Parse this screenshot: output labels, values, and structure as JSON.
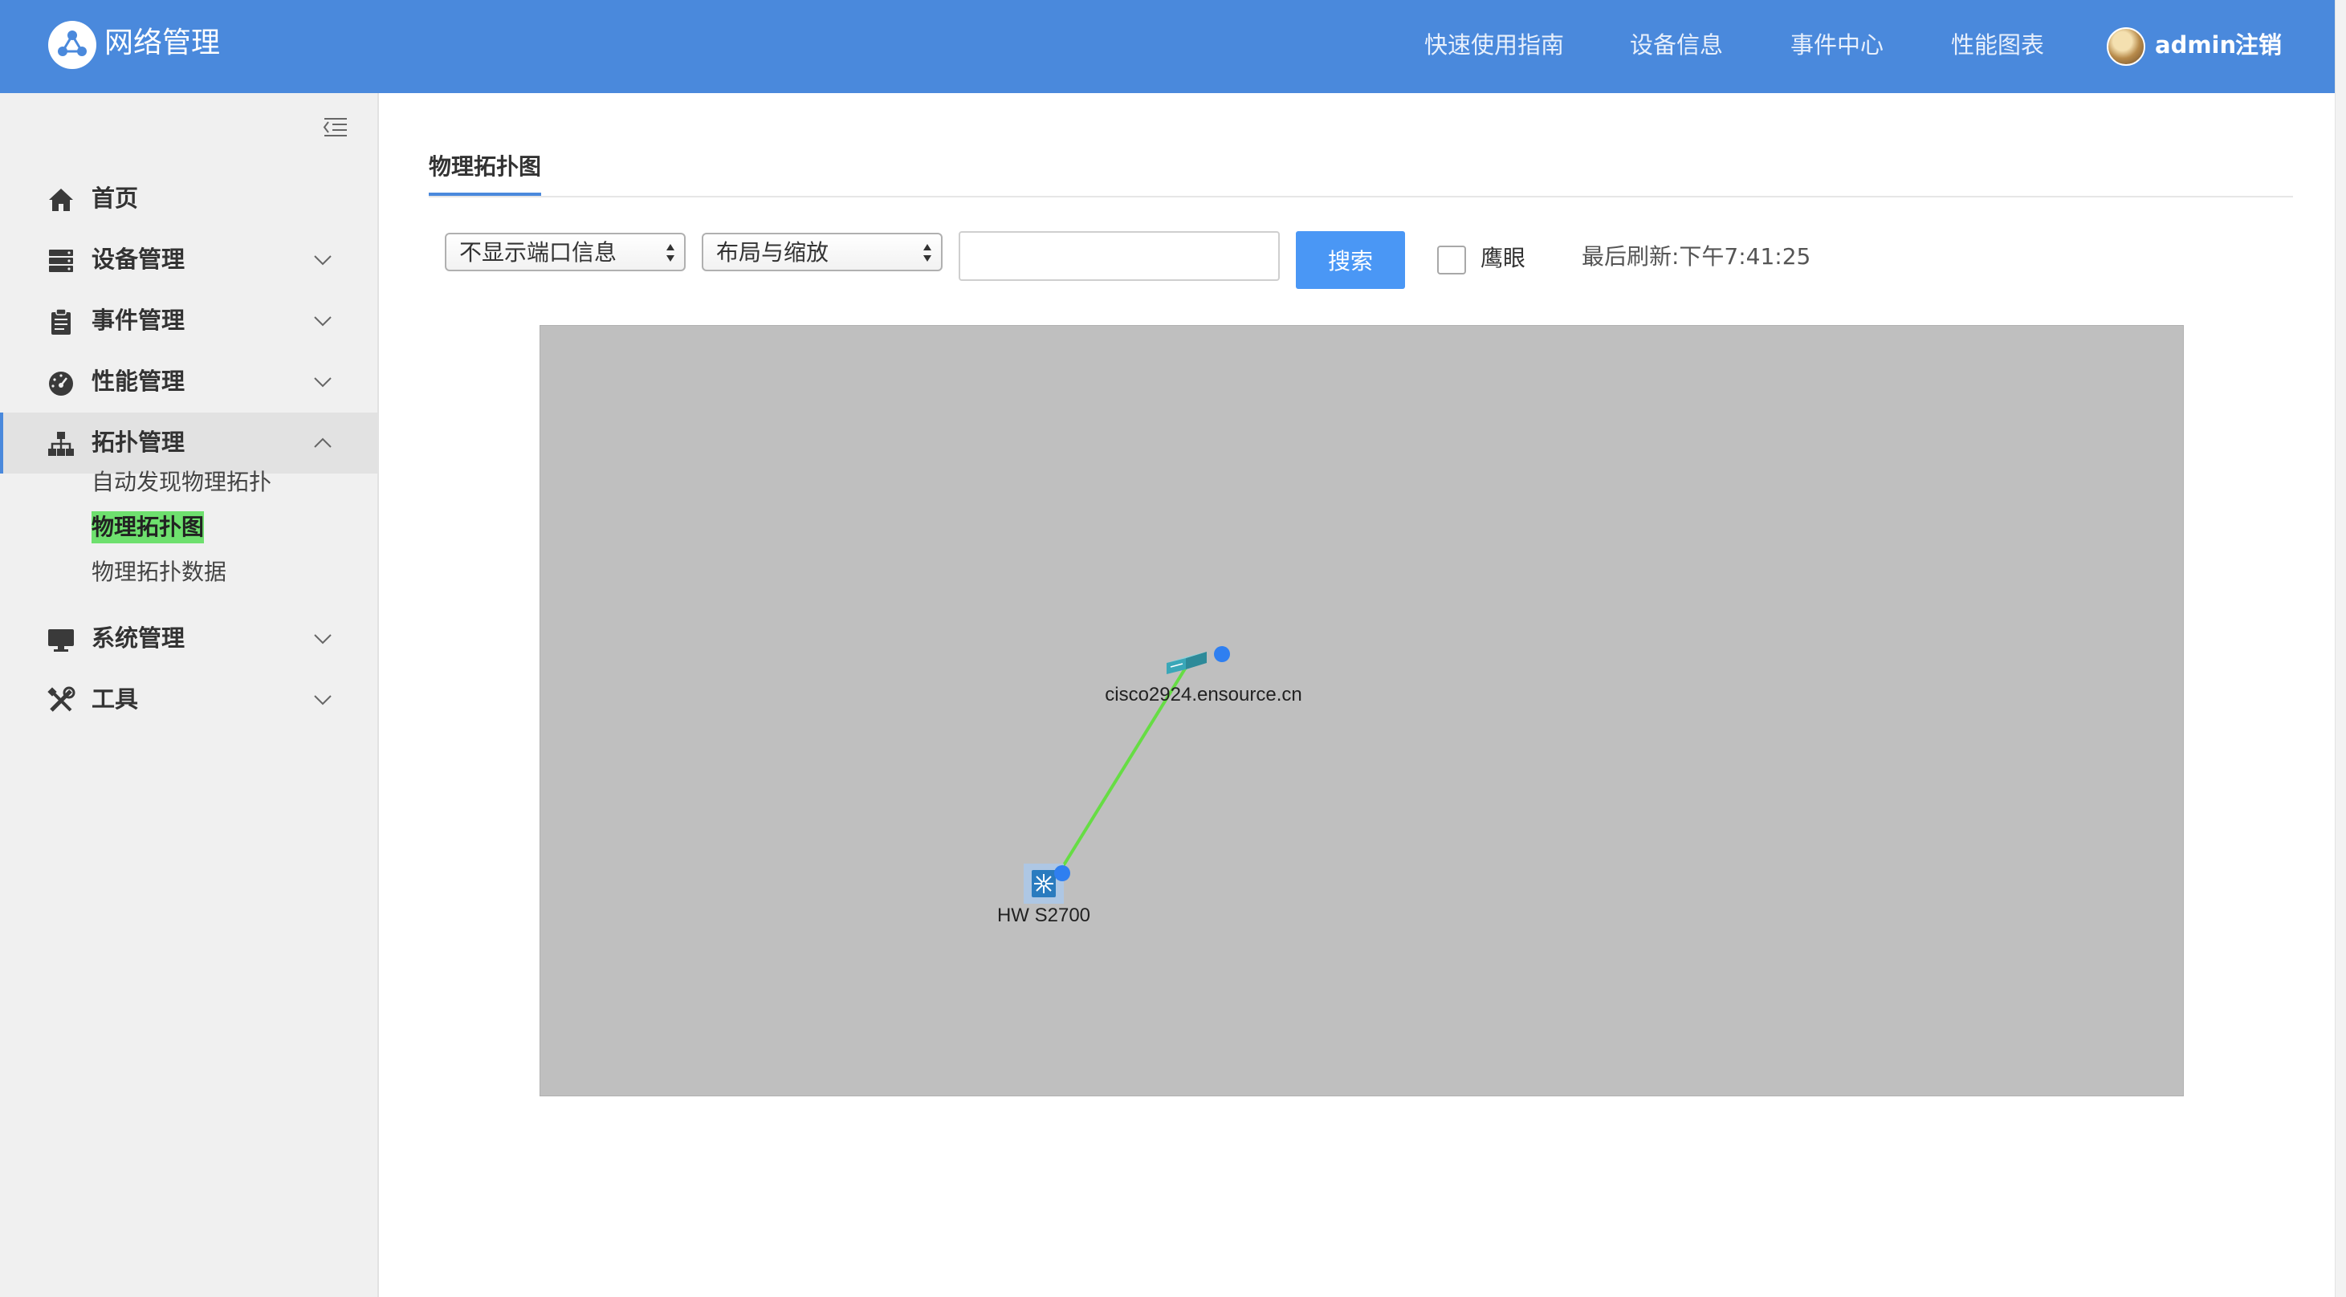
{
  "app": {
    "title": "网络管理",
    "logo_icon": "network-logo-icon"
  },
  "header": {
    "nav": [
      {
        "label": "快速使用指南"
      },
      {
        "label": "设备信息"
      },
      {
        "label": "事件中心"
      },
      {
        "label": "性能图表"
      }
    ],
    "user": {
      "name": "admin",
      "logout_label": "注销"
    }
  },
  "sidebar": {
    "items": [
      {
        "label": "首页",
        "icon": "home-icon",
        "expandable": false
      },
      {
        "label": "设备管理",
        "icon": "server-icon",
        "expandable": true,
        "expanded": false
      },
      {
        "label": "事件管理",
        "icon": "clipboard-icon",
        "expandable": true,
        "expanded": false
      },
      {
        "label": "性能管理",
        "icon": "dashboard-icon",
        "expandable": true,
        "expanded": false
      },
      {
        "label": "拓扑管理",
        "icon": "sitemap-icon",
        "expandable": true,
        "expanded": true,
        "active": true,
        "children": [
          {
            "label": "自动发现物理拓扑"
          },
          {
            "label": "物理拓扑图",
            "selected": true
          },
          {
            "label": "物理拓扑数据"
          }
        ]
      },
      {
        "label": "系统管理",
        "icon": "desktop-icon",
        "expandable": true,
        "expanded": false
      },
      {
        "label": "工具",
        "icon": "tools-icon",
        "expandable": true,
        "expanded": false
      }
    ]
  },
  "main": {
    "tab": "物理拓扑图",
    "toolbar": {
      "port_select": "不显示端口信息",
      "layout_select": "布局与缩放",
      "search_value": "",
      "search_label": "搜索",
      "eagle_eye_label": "鹰眼",
      "eagle_eye_checked": false,
      "last_refresh": "最后刷新:下午7:41:25"
    },
    "topology": {
      "background": "#bfbfbf",
      "link_color": "#66dd44",
      "status_dot_color": "#2f7ff0",
      "nodes": [
        {
          "id": "cisco",
          "label": "cisco2924.ensource.cn",
          "icon": "switch-icon"
        },
        {
          "id": "hw",
          "label": "HW S2700",
          "icon": "switch-selected-icon"
        }
      ],
      "links": [
        {
          "from": "cisco",
          "to": "hw"
        }
      ]
    }
  }
}
